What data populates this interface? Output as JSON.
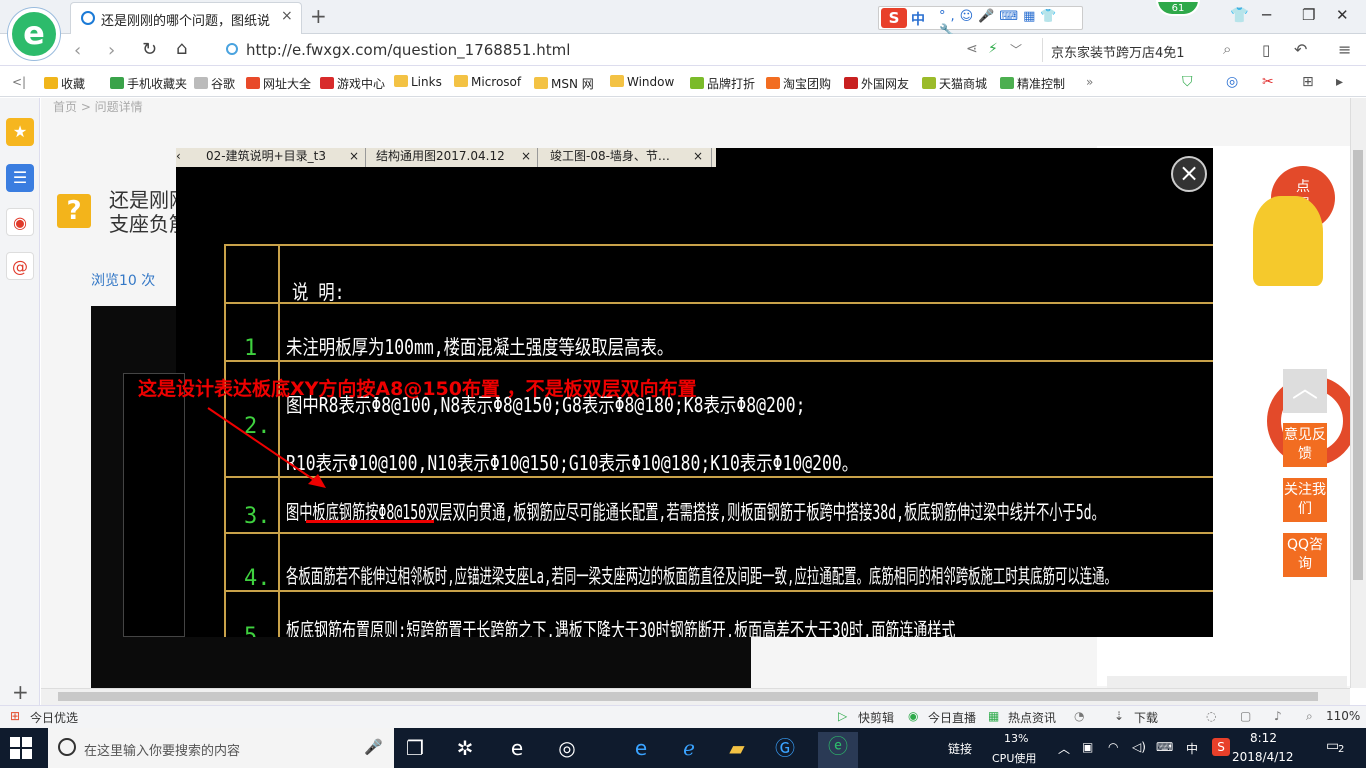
{
  "browser": {
    "tab_title": "还是刚刚的哪个问题，图纸说明制",
    "tab_close": "×",
    "new_tab": "+",
    "ime": {
      "logo": "S",
      "mode": "中"
    },
    "badge": "61",
    "url": "http://e.fwxgx.com/question_1768851.html",
    "search_text": "京东家装节跨万店4免1"
  },
  "bookmarks": [
    {
      "label": "收藏",
      "color": "#f0b51b"
    },
    {
      "label": "手机收藏夹",
      "color": "#3aa34a"
    },
    {
      "label": "谷歌",
      "color": "#bbbbbb"
    },
    {
      "label": "网址大全",
      "color": "#e84a2a"
    },
    {
      "label": "游戏中心",
      "color": "#d82b2b"
    },
    {
      "label": "Links",
      "color": "#f3c244"
    },
    {
      "label": "Microsof",
      "color": "#f3c244"
    },
    {
      "label": "MSN 网",
      "color": "#f3c244"
    },
    {
      "label": "Window",
      "color": "#f3c244"
    },
    {
      "label": "品牌打折",
      "color": "#7bbb2a"
    },
    {
      "label": "淘宝团购",
      "color": "#f26d21"
    },
    {
      "label": "外国网友",
      "color": "#c82020"
    },
    {
      "label": "天猫商城",
      "color": "#9bbb2a"
    },
    {
      "label": "精准控制",
      "color": "#4caf50"
    }
  ],
  "page": {
    "question_title_1": "还是刚刚",
    "question_title_2": "支座负筋",
    "views": "浏览10 次",
    "breadcrumb": "首页 > 问题详情"
  },
  "viewer": {
    "tabs": [
      "02-建筑说明+目录_t3",
      "结构通用图2017.04.12",
      "竣工图-08-墙身、节…"
    ],
    "tab_close": "×",
    "close": "×",
    "header": "说 明:",
    "rows": [
      {
        "num": "1",
        "lines": [
          "未注明板厚为100mm,楼面混凝土强度等级取层高表。"
        ]
      },
      {
        "num": "2.",
        "lines": [
          "图中R8表示Φ8@100,N8表示Φ8@150;G8表示Φ8@180;K8表示Φ8@200;",
          "R10表示Φ10@100,N10表示Φ10@150;G10表示Φ10@180;K10表示Φ10@200。"
        ]
      },
      {
        "num": "3.",
        "lines": [
          "图中板底钢筋按Φ8@150双层双向贯通,板钢筋应尽可能通长配置,若需搭接,则板面钢筋于板跨中搭接38d,板底钢筋伸过梁中线并不小于5d。"
        ]
      },
      {
        "num": "4.",
        "lines": [
          "各板面筋若不能伸过相邻板时,应锚进梁支座La,若同一梁支座两边的板面筋直径及间距一致,应拉通配置。底筋相同的相邻跨板施工时其底筋可以连通。"
        ]
      },
      {
        "num": "5.",
        "lines": [
          "板底钢筋布置原则:短跨筋置于长跨筋之下,遇板下降大于30时钢筋断开,板面高差不大于30时,面筋连通样式"
        ]
      }
    ],
    "annotation": "这是设计表达板底XY方向按A8@150布置 ，不是板双层双向布置"
  },
  "float_buttons": [
    "意见反馈",
    "关注我们",
    "QQ咨询"
  ],
  "statusbar": {
    "left": "今日优选",
    "items": [
      "快剪辑",
      "今日直播",
      "热点资讯",
      "下载"
    ],
    "zoom": "110%"
  },
  "taskbar": {
    "search_placeholder": "在这里输入你要搜索的内容",
    "link": "链接",
    "cpu_percent": "13%",
    "cpu_label": "CPU使用",
    "ime": "中",
    "time": "8:12",
    "date": "2018/4/12",
    "notifications": "2"
  }
}
